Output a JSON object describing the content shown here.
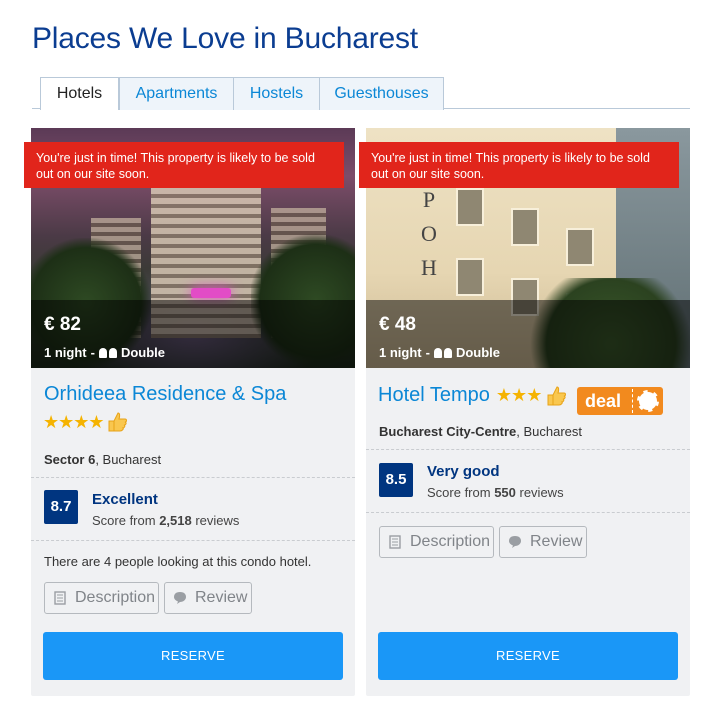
{
  "page_title": "Places We Love in Bucharest",
  "tabs": [
    {
      "label": "Hotels",
      "active": true
    },
    {
      "label": "Apartments",
      "active": false
    },
    {
      "label": "Hostels",
      "active": false
    },
    {
      "label": "Guesthouses",
      "active": false
    }
  ],
  "cards": [
    {
      "alert": "You're just in time! This property is likely to be sold out on our site soon.",
      "price": "€ 82",
      "nights": "1 night",
      "dash": "-",
      "room": "Double",
      "name": "Orhideea Residence & Spa",
      "stars": "★★★★",
      "star_count": 4,
      "district": "Sector 6",
      "city": ", Bucharest",
      "score": "8.7",
      "score_word": "Excellent",
      "score_from_prefix": "Score from ",
      "review_count": "2,518",
      "score_from_suffix": " reviews",
      "looking": "There are 4 people looking at this condo hotel.",
      "description_label": "Description",
      "review_label": "Review",
      "reserve_label": "RESERVE"
    },
    {
      "alert": "You're just in time! This property is likely to be sold out on our site soon.",
      "price": "€ 48",
      "nights": "1 night",
      "dash": "-",
      "room": "Double",
      "name": "Hotel Tempo",
      "stars": "★★★",
      "star_count": 3,
      "deal_label": "deal",
      "district": "Bucharest City-Centre",
      "city": ", Bucharest",
      "score": "8.5",
      "score_word": "Very good",
      "score_from_prefix": "Score from ",
      "review_count": "550",
      "score_from_suffix": " reviews",
      "description_label": "Description",
      "review_label": "Review",
      "reserve_label": "RESERVE"
    }
  ],
  "colors": {
    "title": "#0b3d91",
    "link": "#0b87d6",
    "alert": "#e1251b",
    "score": "#003580",
    "reserve": "#1a97f7",
    "deal": "#f28a1e",
    "star": "#f5b301"
  }
}
